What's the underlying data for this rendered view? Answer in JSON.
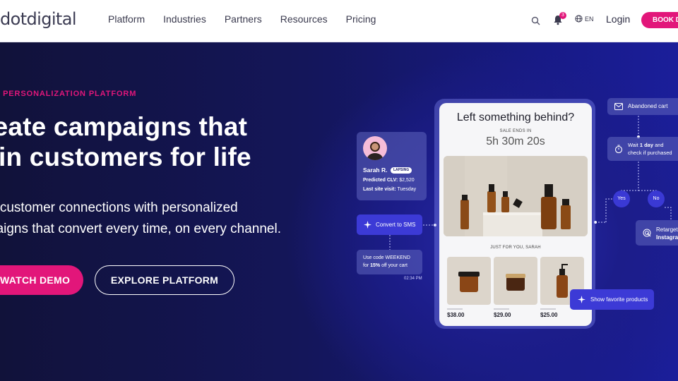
{
  "nav": {
    "logo": "dotdigital",
    "links": [
      "Platform",
      "Industries",
      "Partners",
      "Resources",
      "Pricing"
    ],
    "notification_count": "3",
    "language": "EN",
    "login": "Login",
    "book": "BOOK D"
  },
  "hero": {
    "eyebrow": "ETING PERSONALIZATION PLATFORM",
    "headline_line1": "reate campaigns that",
    "headline_line2": "in customers for life",
    "sub_line1": "d customer connections with personalized",
    "sub_line2": "paigns that convert every time, on every channel.",
    "watch_demo": "WATCH DEMO",
    "explore": "EXPLORE PLATFORM"
  },
  "phone": {
    "title": "Left something behind?",
    "sale_label": "SALE ENDS IN",
    "timer": "5h 30m 20s",
    "just_for_you": "JUST FOR YOU, SARAH",
    "products": [
      {
        "price": "$38.00"
      },
      {
        "price": "$29.00"
      },
      {
        "price": "$25.00"
      }
    ]
  },
  "profile": {
    "name": "Sarah R.",
    "status": "LAPSING",
    "clv_label": "Predicted CLV:",
    "clv_value": "$2,520",
    "visit_label": "Last site visit:",
    "visit_value": "Tuesday"
  },
  "cards": {
    "sms": "Convert to SMS",
    "code_line1": "Use code WEEKEND",
    "code_line2_pre": "for ",
    "code_line2_bold": "15%",
    "code_line2_post": " off your cart",
    "code_time": "02:34 PM",
    "favorite": "Show favorite products",
    "abandoned": "Abandoned cart",
    "wait_pre": "Wait ",
    "wait_bold": "1 day",
    "wait_post": " and",
    "wait_line2": "check if purchased",
    "yes": "Yes",
    "no": "No",
    "retarget_line1": "Retarget",
    "retarget_line2": "Instagram"
  },
  "colors": {
    "brand_pink": "#e2167a",
    "hero_navy": "#14165a",
    "accent_blue": "#3c3ad6"
  }
}
